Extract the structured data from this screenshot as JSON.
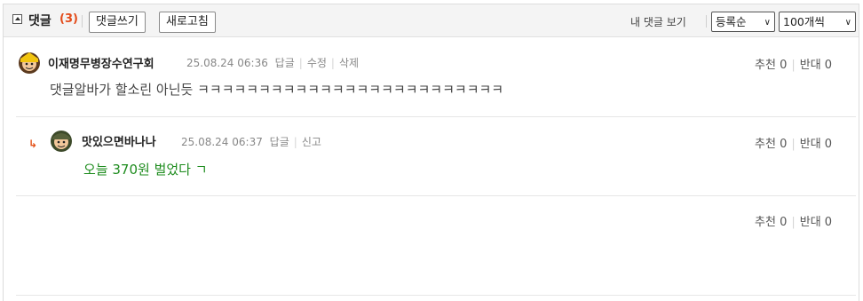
{
  "header": {
    "title": "댓글",
    "count": "(3)",
    "write_button": "댓글쓰기",
    "refresh_button": "새로고침",
    "my_comments": "내 댓글 보기",
    "sort_selected": "등록순",
    "page_size_selected": "100개씩"
  },
  "comments": [
    {
      "nickname": "이재명무병장수연구회",
      "datetime": "25.08.24 06:36",
      "actions": [
        "답글",
        "수정",
        "삭제"
      ],
      "text": "댓글알바가 할소린 아닌듯 ㅋㅋㅋㅋㅋㅋㅋㅋㅋㅋㅋㅋㅋㅋㅋㅋㅋㅋㅋㅋㅋㅋㅋㅋㅋ",
      "recommend_label": "추천",
      "recommend": "0",
      "oppose_label": "반대",
      "oppose": "0"
    },
    {
      "nickname": "맛있으면바나나",
      "datetime": "25.08.24 06:37",
      "actions": [
        "답글",
        "신고"
      ],
      "text": "오늘 370원 벌었다 ㄱ",
      "recommend_label": "추천",
      "recommend": "0",
      "oppose_label": "반대",
      "oppose": "0"
    },
    {
      "recommend_label": "추천",
      "recommend": "0",
      "oppose_label": "반대",
      "oppose": "0"
    }
  ],
  "colors": {
    "count_red": "#e34b1a",
    "reply_text_green": "#1e8c1e",
    "reply_arrow": "#e4531a"
  }
}
